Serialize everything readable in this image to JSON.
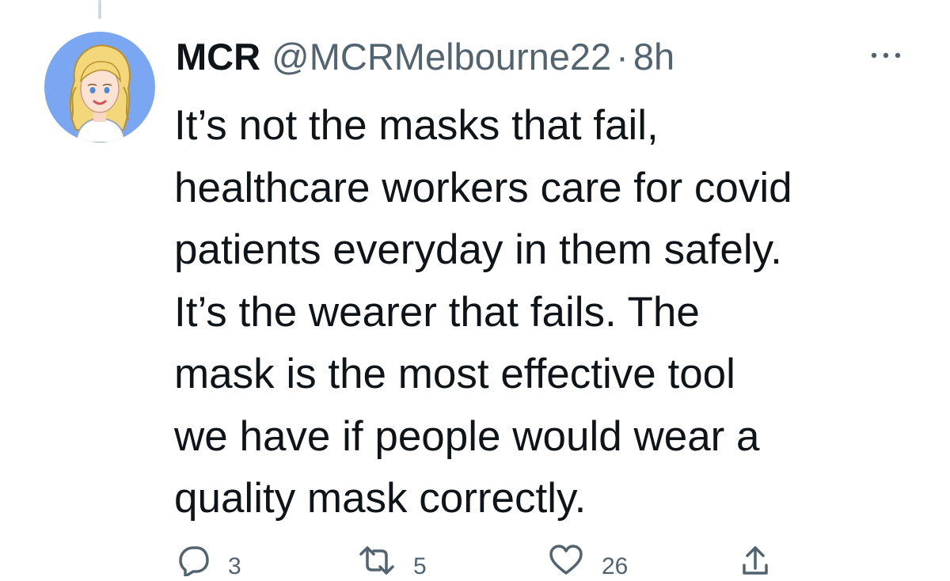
{
  "tweet": {
    "author": {
      "display_name": "MCR",
      "handle": "@MCRMelbourne22",
      "avatar_icon": "bitmoji-avatar-icon"
    },
    "separator": "·",
    "time": "8h",
    "text": "It’s not the masks that fail,\nhealthcare workers care for covid\npatients everyday in them safely.\nIt’s the wearer that fails. The\nmask is the most effective tool\nwe have if people would wear a\nquality mask correctly.",
    "actions": {
      "reply": {
        "icon": "reply-icon",
        "count": "3"
      },
      "retweet": {
        "icon": "retweet-icon",
        "count": "5"
      },
      "like": {
        "icon": "heart-icon",
        "count": "26"
      },
      "share": {
        "icon": "share-icon"
      }
    },
    "more_icon": "more-options-icon"
  },
  "colors": {
    "text_primary": "#0f1419",
    "text_secondary": "#536471",
    "avatar_background": "#7ba7f2"
  }
}
